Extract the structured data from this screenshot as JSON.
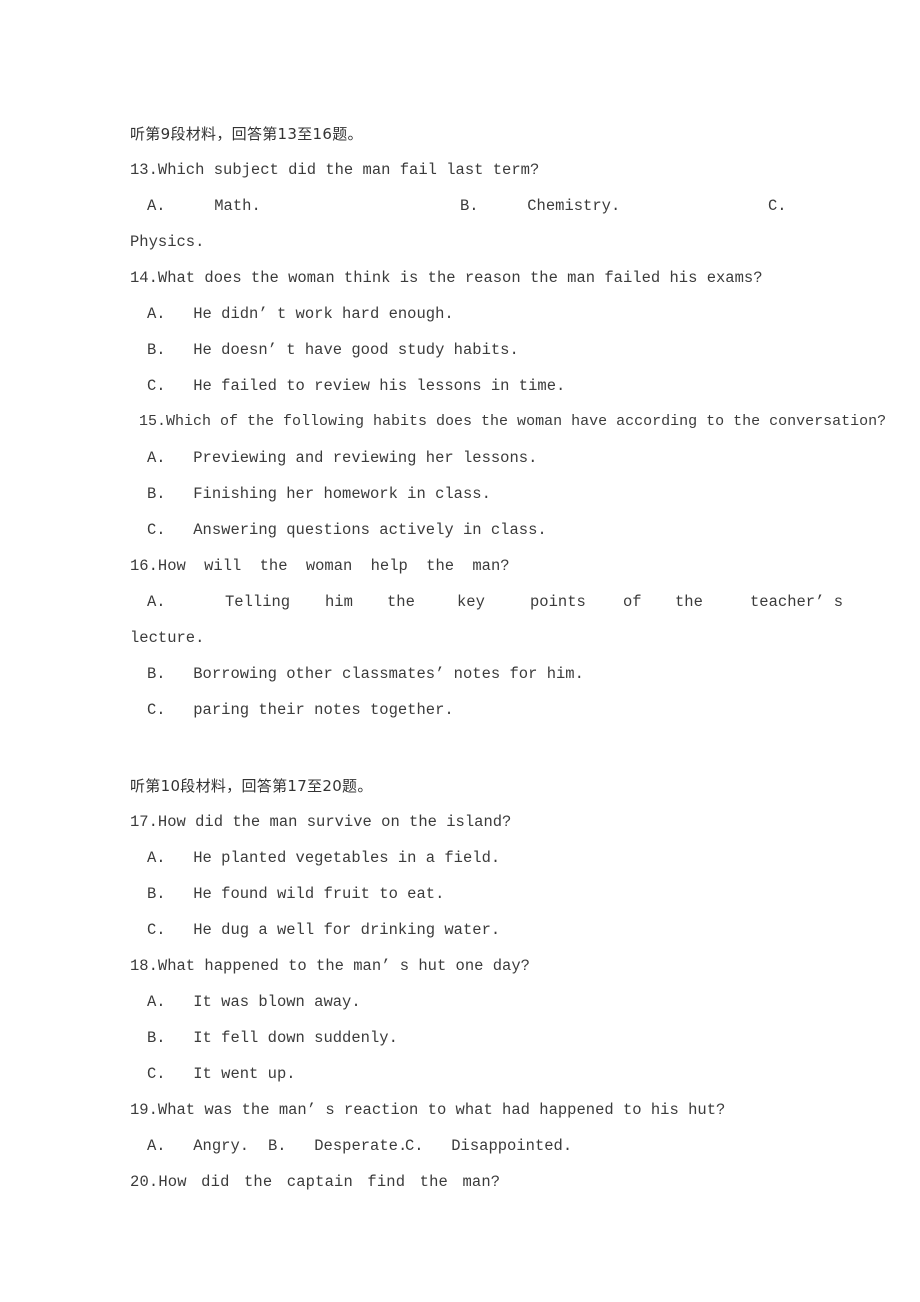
{
  "document": {
    "type": "english-listening-exam-paper",
    "text_color": "#3b3b3b",
    "background_color": "#ffffff",
    "sections": [
      {
        "heading": "听第 9 段材料，回答第 13 至 16 题。",
        "heading_plain": "听第9段材料，回答第13至16题。",
        "questions": [
          {
            "number": "13.",
            "stem": "13.Which subject did the man fail last term?",
            "layout": "spread-row",
            "options": [
              {
                "label": "A.",
                "text": "Math."
              },
              {
                "label": "B.",
                "text": "Chemistry."
              },
              {
                "label": "C.",
                "text": ""
              }
            ],
            "overflow_line": "Physics."
          },
          {
            "number": "14.",
            "stem": "14.What does the woman think is the reason the man failed his exams?",
            "layout": "stacked",
            "options": [
              {
                "label": "A.",
                "text": "He didn’ t work hard enough."
              },
              {
                "label": "B.",
                "text": "He doesn’ t have good study habits."
              },
              {
                "label": "C.",
                "text": "He failed to review his lessons in time."
              }
            ]
          },
          {
            "number": "15.",
            "stem": "15.Which of the following habits does the woman have according to the conversation?",
            "layout": "stacked",
            "options": [
              {
                "label": "A.",
                "text": "Previewing and reviewing her lessons."
              },
              {
                "label": "B.",
                "text": "Finishing her homework in class."
              },
              {
                "label": "C.",
                "text": "Answering questions actively in class."
              }
            ]
          },
          {
            "number": "16.",
            "stem": "16.How  will  the  woman help  the  man?",
            "layout": "stacked",
            "options": [
              {
                "label": "A.",
                "text": "Telling him the key points of the teacher’ s lecture."
              },
              {
                "label": "B.",
                "text": "Borrowing other classmates’  notes for him."
              },
              {
                "label": "C.",
                "text": "paring their notes together."
              }
            ],
            "option_a_words": [
              "A.",
              "Telling",
              "him",
              "the",
              "key",
              "points",
              "of",
              "the",
              "teacher’ s"
            ],
            "option_a_overflow": "lecture."
          }
        ]
      },
      {
        "heading": "听第 10 段材料，回答第 17 至 20 题。",
        "heading_plain": "听第10段材料，回答第17至20题。",
        "questions": [
          {
            "number": "17.",
            "stem": "17.How did the man survive on the island?",
            "layout": "stacked",
            "options": [
              {
                "label": "A.",
                "text": "He planted vegetables in a field."
              },
              {
                "label": "B.",
                "text": "He found wild fruit to eat."
              },
              {
                "label": "C.",
                "text": "He dug a well for drinking water."
              }
            ]
          },
          {
            "number": "18.",
            "stem": "18.What happened to the man’ s hut one day?",
            "layout": "stacked",
            "options": [
              {
                "label": "A.",
                "text": "It was blown away."
              },
              {
                "label": "B.",
                "text": "It fell down suddenly."
              },
              {
                "label": "C.",
                "text": "It went up."
              }
            ]
          },
          {
            "number": "19.",
            "stem": "19.What  was  the  man’ s reaction to what had happened to his hut?",
            "layout": "inline-row",
            "options": [
              {
                "label": "A.",
                "text": "Angry."
              },
              {
                "label": "B.",
                "text": "Desperate."
              },
              {
                "label": "C.",
                "text": "Disappointed."
              }
            ]
          },
          {
            "number": "20.",
            "stem": "20.How  did  the  captain find the man?",
            "layout": "stem-only",
            "options": []
          }
        ]
      }
    ]
  }
}
